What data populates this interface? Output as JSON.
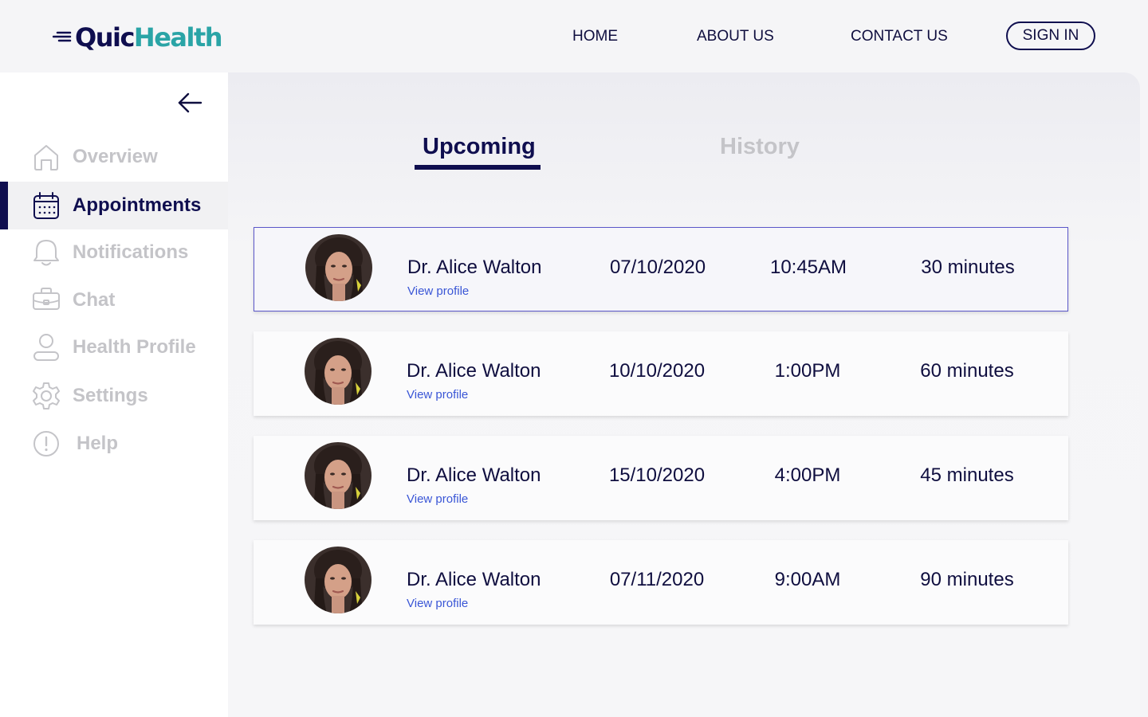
{
  "brand": {
    "quic": "Quic",
    "health": "Health",
    "color_navy": "#0f0e4f",
    "color_teal": "#2aa4a6"
  },
  "nav": {
    "home": "HOME",
    "about": "ABOUT US",
    "contact": "CONTACT US",
    "signin": "SIGN IN"
  },
  "sidebar": {
    "items": [
      {
        "label": "Overview",
        "icon": "home-icon",
        "active": false
      },
      {
        "label": "Appointments",
        "icon": "calendar-icon",
        "active": true
      },
      {
        "label": "Notifications",
        "icon": "bell-icon",
        "active": false
      },
      {
        "label": "Chat",
        "icon": "chat-icon",
        "active": false
      },
      {
        "label": "Health Profile",
        "icon": "user-icon",
        "active": false
      },
      {
        "label": "Settings",
        "icon": "gear-icon",
        "active": false
      },
      {
        "label": "Help",
        "icon": "alert-icon",
        "active": false
      }
    ]
  },
  "tabs": {
    "upcoming": "Upcoming",
    "history": "History",
    "active": "upcoming"
  },
  "appointments": [
    {
      "doctor": "Dr. Alice Walton",
      "link": "View profile",
      "date": "07/10/2020",
      "time": "10:45AM",
      "duration": "30 minutes",
      "selected": true
    },
    {
      "doctor": "Dr. Alice Walton",
      "link": "View profile",
      "date": "10/10/2020",
      "time": "1:00PM",
      "duration": "60 minutes",
      "selected": false
    },
    {
      "doctor": "Dr. Alice Walton",
      "link": "View profile",
      "date": "15/10/2020",
      "time": "4:00PM",
      "duration": "45 minutes",
      "selected": false
    },
    {
      "doctor": "Dr. Alice Walton",
      "link": "View profile",
      "date": "07/11/2020",
      "time": "9:00AM",
      "duration": "90 minutes",
      "selected": false
    }
  ]
}
